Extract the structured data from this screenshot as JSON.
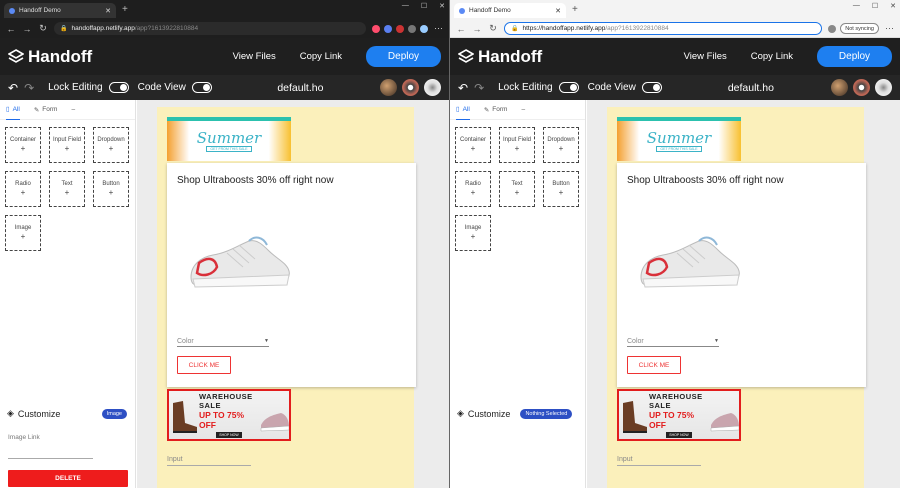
{
  "windows": [
    {
      "id": "w1",
      "browser": {
        "tab_title": "Handoff Demo",
        "url_host": "handoffapp.netlify.app",
        "url_path": "/app?1613922810884",
        "url_prefix": ""
      },
      "customize_badge": "Image",
      "show_image_link": true
    },
    {
      "id": "w2",
      "browser": {
        "tab_title": "Handoff Demo",
        "url_host": "handoffapp.netlify.app",
        "url_path": "/app?1613922810884",
        "url_prefix": "https://",
        "sync_label": "Not syncing"
      },
      "customize_badge": "Nothing Selected",
      "show_image_link": false
    }
  ],
  "app": {
    "logo": "Handoff",
    "view_files": "View Files",
    "copy_link": "Copy Link",
    "deploy": "Deploy",
    "lock_editing": "Lock Editing",
    "code_view": "Code View",
    "filename": "default.ho"
  },
  "sidebar": {
    "tab_all": "All",
    "tab_form": "Form",
    "tab_more": "–",
    "components": [
      "Container",
      "Input Field",
      "Dropdown",
      "Radio",
      "Text",
      "Button",
      "Image"
    ],
    "customize": "Customize",
    "image_link_label": "Image Link",
    "delete": "DELETE"
  },
  "canvas": {
    "banner_title": "Summer",
    "banner_sub": "GET FROM THIS SALE",
    "card_title": "Shop Ultraboosts 30% off right now",
    "color_label": "Color",
    "click_me": "CLICK ME",
    "ware_line1": "WAREHOUSE SALE",
    "ware_line2": "UP TO 75% OFF",
    "ware_line3": "SHOP NOW",
    "input_label": "Input"
  }
}
